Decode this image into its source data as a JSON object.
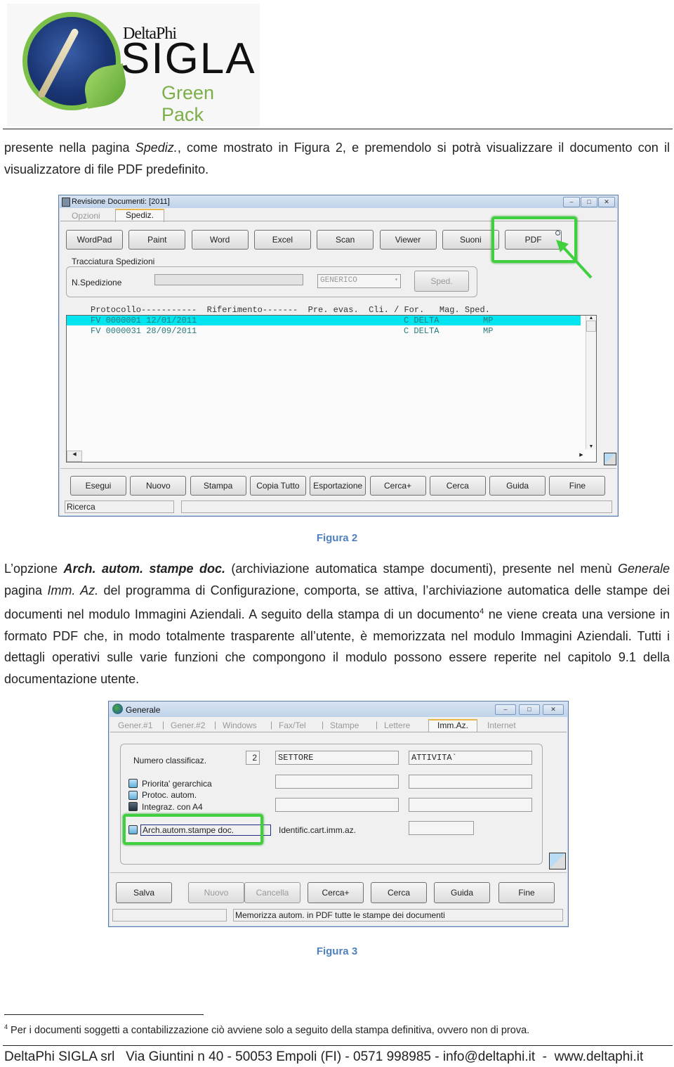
{
  "logo": {
    "brand_small": "DeltaPhi",
    "brand_main": "SIGLA",
    "brand_sub": "Green Pack"
  },
  "intro": {
    "text_before": "presente nella pagina ",
    "text_italic": "Spediz.",
    "text_after": ", come mostrato in Figura 2, e premendolo si potrà visualizzare il documento con il visualizzatore di file PDF predefinito."
  },
  "figure2": {
    "caption": "Figura 2",
    "window_title": "Revisione Documenti: [2011]",
    "window_controls": [
      "minimize",
      "maximize",
      "close"
    ],
    "tabs": [
      {
        "label": "Opzioni",
        "active": false
      },
      {
        "label": "Spediz.",
        "active": true
      }
    ],
    "top_buttons": [
      "WordPad",
      "Paint",
      "Word",
      "Excel",
      "Scan",
      "Viewer",
      "Suoni",
      "PDF"
    ],
    "highlighted_button": "PDF",
    "group_label": "Tracciatura Spedizioni",
    "n_spedizione_label": "N.Spedizione",
    "n_spedizione_value": "",
    "combo_value": "GENERICO",
    "sped_button": "Sped.",
    "list_header": "Protocollo-----------  Riferimento-------  Pre. evas.  Cli. / For.   Mag. Sped.",
    "columns": [
      "Protocollo",
      "Riferimento",
      "Pre. evas.",
      "Cli. / For.",
      "Mag. Sped."
    ],
    "rows": [
      {
        "protocollo": "FV 0000001 12/01/2011",
        "riferimento": "",
        "pre_evas": "",
        "cli_for": "C DELTA",
        "mag_sped": "MP",
        "selected": true
      },
      {
        "protocollo": "FV 0000031 28/09/2011",
        "riferimento": "",
        "pre_evas": "",
        "cli_for": "C DELTA",
        "mag_sped": "MP",
        "selected": false
      }
    ],
    "bottom_buttons": [
      "Esegui",
      "Nuovo",
      "Stampa",
      "Copia Tutto",
      "Esportazione",
      "Cerca+",
      "Cerca",
      "Guida",
      "Fine"
    ],
    "status_left": "Ricerca",
    "status_right": "",
    "selection_color": "#00e5f0",
    "highlight_color": "#3fcf3f"
  },
  "body": {
    "p1_a": "L’opzione ",
    "p1_b": "Arch. autom. stampe doc.",
    "p1_c": " (archiviazione automatica stampe documenti), presente nel menù ",
    "p1_d": "Generale",
    "p1_e": " pagina ",
    "p1_f": "Imm. Az.",
    "p1_g": " del programma di Configurazione, comporta, se attiva, l’archiviazione automatica delle stampe dei documenti nel modulo Immagini Aziendali. A seguito della stampa di un documento",
    "p1_sup": "4",
    "p1_h": " ne viene creata una versione in formato PDF che, in modo totalmente trasparente all’utente, è memorizzata nel modulo Immagini Aziendali. Tutti i dettagli operativi sulle varie funzioni che compongono il modulo possono essere reperite nel capitolo 9.1 della documentazione utente."
  },
  "figure3": {
    "caption": "Figura 3",
    "window_title": "Generale",
    "tabs": [
      {
        "label": "Gener.#1",
        "active": false
      },
      {
        "label": "Gener.#2",
        "active": false
      },
      {
        "label": "Windows",
        "active": false
      },
      {
        "label": "Fax/Tel",
        "active": false
      },
      {
        "label": "Stampe",
        "active": false
      },
      {
        "label": "Lettere",
        "active": false
      },
      {
        "label": "Imm.Az.",
        "active": true
      },
      {
        "label": "Internet",
        "active": false
      }
    ],
    "numero_label": "Numero classificaz.",
    "numero_value": "2",
    "settore_value": "SETTORE",
    "attivita_value": "ATTIVITA`",
    "checkboxes": [
      {
        "label": "Priorita' gerarchica",
        "checked": false
      },
      {
        "label": "Protoc. autom.",
        "checked": false
      },
      {
        "label": "Integraz. con A4",
        "checked": true
      },
      {
        "label": "Arch.autom.stampe doc.",
        "checked": false
      }
    ],
    "identific_label": "Identific.cart.imm.az.",
    "identific_value": "",
    "buttons": [
      {
        "label": "Salva",
        "enabled": true
      },
      {
        "label": "Nuovo",
        "enabled": false
      },
      {
        "label": "Cancella",
        "enabled": false
      },
      {
        "label": "Cerca+",
        "enabled": true
      },
      {
        "label": "Cerca",
        "enabled": true
      },
      {
        "label": "Guida",
        "enabled": true
      },
      {
        "label": "Fine",
        "enabled": true
      }
    ],
    "status_left": "",
    "status_right": "Memorizza autom. in PDF tutte le stampe dei documenti"
  },
  "footnote": {
    "number": "4",
    "text": "Per i documenti soggetti a contabilizzazione ciò avviene solo a seguito della stampa definitiva, ovvero non di prova."
  },
  "footer": {
    "text": "DeltaPhi SIGLA srl   Via Giuntini n 40 - 50053 Empoli (FI) - 0571 998985 - info@deltaphi.it  -  www.deltaphi.it"
  }
}
